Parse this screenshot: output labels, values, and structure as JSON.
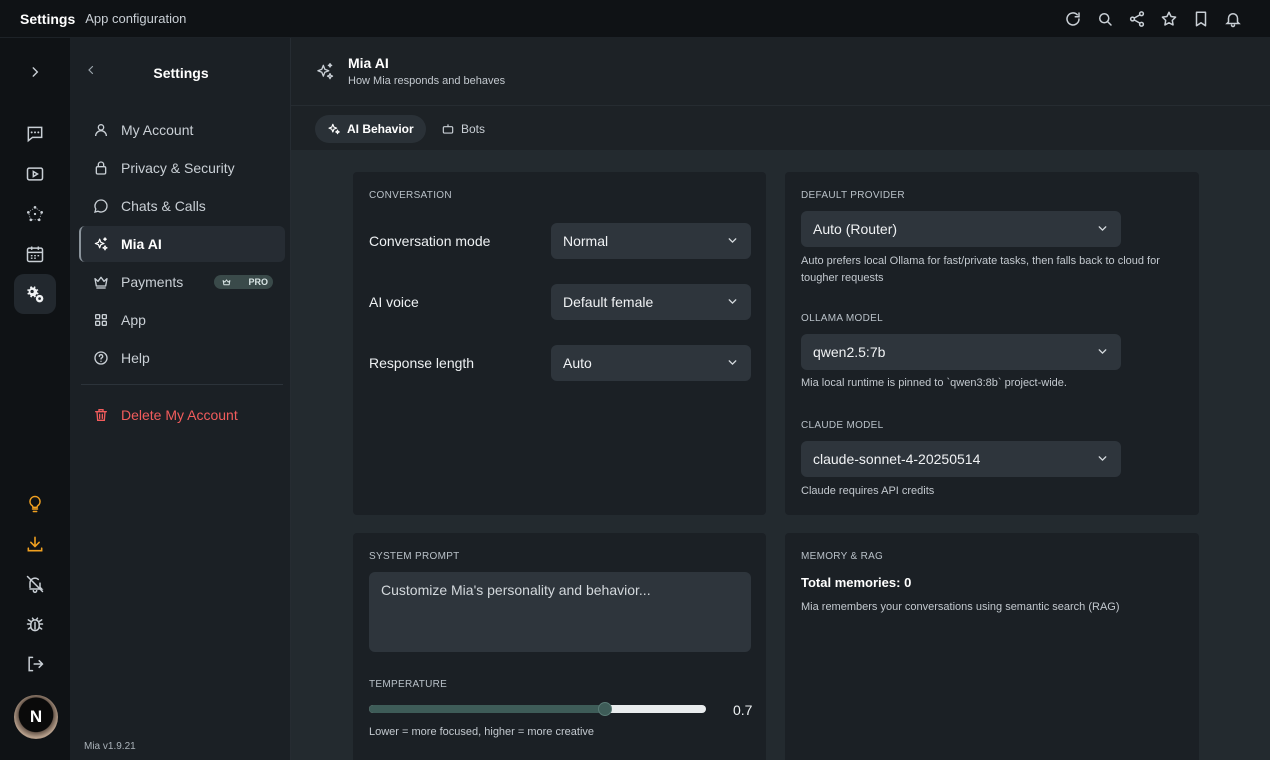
{
  "topbar": {
    "title": "Settings",
    "subtitle": "App configuration"
  },
  "sidebar": {
    "title": "Settings",
    "items": [
      {
        "label": "My Account"
      },
      {
        "label": "Privacy & Security"
      },
      {
        "label": "Chats & Calls"
      },
      {
        "label": "Mia AI"
      },
      {
        "label": "Payments",
        "badge": "PRO"
      },
      {
        "label": "App"
      },
      {
        "label": "Help"
      }
    ],
    "delete_label": "Delete My Account",
    "version": "Mia v1.9.21"
  },
  "rail": {
    "avatar_initial": "N"
  },
  "header": {
    "title": "Mia AI",
    "subtitle": "How Mia responds and behaves"
  },
  "tabs": [
    {
      "label": "AI Behavior"
    },
    {
      "label": "Bots"
    }
  ],
  "conversation": {
    "heading": "CONVERSATION",
    "mode_label": "Conversation mode",
    "mode_value": "Normal",
    "voice_label": "AI voice",
    "voice_value": "Default female",
    "length_label": "Response length",
    "length_value": "Auto"
  },
  "provider": {
    "heading": "DEFAULT PROVIDER",
    "value": "Auto (Router)",
    "help": "Auto prefers local Ollama for fast/private tasks, then falls back to cloud for tougher requests",
    "ollama_heading": "OLLAMA MODEL",
    "ollama_value": "qwen2.5:7b",
    "ollama_help": "Mia local runtime is pinned to `qwen3:8b` project-wide.",
    "claude_heading": "CLAUDE MODEL",
    "claude_value": "claude-sonnet-4-20250514",
    "claude_help": "Claude requires API credits"
  },
  "system_prompt": {
    "heading": "SYSTEM PROMPT",
    "placeholder": "Customize Mia's personality and behavior...",
    "temperature_heading": "TEMPERATURE",
    "temperature_value": "0.7",
    "temperature_fraction": 0.7,
    "temperature_help": "Lower = more focused, higher = more creative"
  },
  "memory": {
    "heading": "MEMORY & RAG",
    "total_label": "Total memories:",
    "total_value": "0",
    "help": "Mia remembers your conversations using semantic search (RAG)"
  },
  "colors": {
    "accent": "#3e5c58",
    "danger": "#f25c5c",
    "rail_highlight": "#f0a020"
  }
}
